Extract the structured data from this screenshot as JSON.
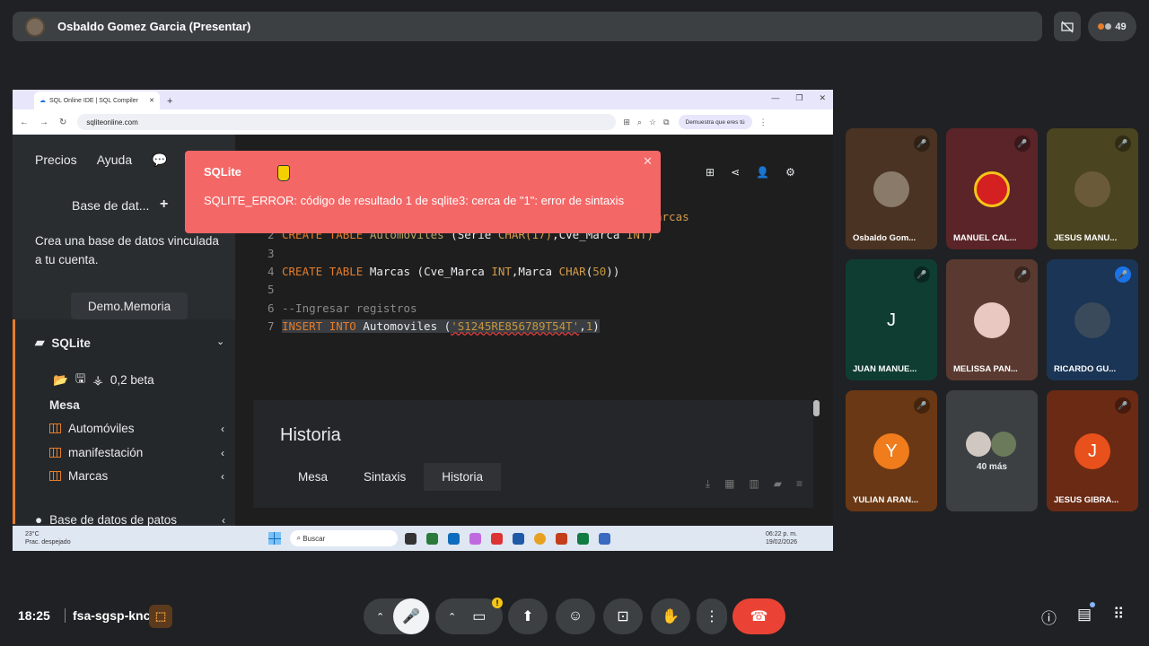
{
  "meet": {
    "presenter_name": "Osbaldo Gomez Garcia (Presentar)",
    "participant_count": "49",
    "time": "18:25",
    "meeting_code": "fsa-sgsp-knc",
    "more_label": "40 más"
  },
  "browser": {
    "tab_title": "SQL Online IDE | SQL Compiler",
    "url": "sqliteonline.com",
    "verify_label": "Demuestra que eres tú"
  },
  "app": {
    "nav": [
      "Precios",
      "Ayuda"
    ],
    "base_datos_label": "Base de dat...",
    "crea_text": "Crea una base de datos vinculada a tu cuenta.",
    "demo_label": "Demo.Memoria",
    "db_title": "SQLite",
    "version": "0,2 beta",
    "mesa_label": "Mesa",
    "tables": [
      "Automóviles",
      "manifestación",
      "Marcas"
    ],
    "patos_label": "Base de datos de patos"
  },
  "editor": {
    "line1_tail": "arcas",
    "line2_num": "2",
    "line2_kw1": "CREATE",
    "line2_kw2": "TABLE",
    "line2_name": "Automoviles",
    "line2_rest": " (Serie ",
    "line2_ty": "CHAR(17)",
    "line2_rest2": ",Cve_Marca ",
    "line2_ty2": "INT)",
    "line3_num": "3",
    "line4_num": "4",
    "line4_kw1": "CREATE",
    "line4_kw2": "TABLE",
    "line4_name": "Marcas",
    "line4_rest": " (Cve_Marca ",
    "line4_ty": "INT",
    "line4_rest2": ",Marca ",
    "line4_ty2": "CHAR",
    "line4_rest3": "(",
    "line4_num50": "50",
    "line4_end": "))",
    "line5_num": "5",
    "line6_num": "6",
    "line6_comment": "--Ingresar registros",
    "line7_num": "7",
    "line7_kw1": "INSERT",
    "line7_kw2": "INTO",
    "line7_name": "Automoviles",
    "line7_open": " (",
    "line7_str": "'S1245RE856789T54T'",
    "line7_comma": ",",
    "line7_val": "1",
    "line7_close": ")"
  },
  "history": {
    "title": "Historia",
    "tabs": [
      "Mesa",
      "Sintaxis",
      "Historia"
    ]
  },
  "error": {
    "title": "SQLite",
    "message": "SQLITE_ERROR: código de resultado 1 de sqlite3: cerca de \"1\": error de sintaxis"
  },
  "taskbar": {
    "weather_temp": "23°C",
    "weather_desc": "Prac. despejado",
    "search_label": "Buscar",
    "clock_time": "06:22 p. m.",
    "clock_date": "19/02/2026"
  },
  "participants": [
    {
      "name": "Osbaldo Gom...",
      "color": "#4a3322"
    },
    {
      "name": "MANUEL CAL...",
      "color": "#5a2428"
    },
    {
      "name": "JESUS MANU...",
      "color": "#4a4420"
    },
    {
      "name": "JUAN MANUE...",
      "color": "#0f3d32",
      "letter": "J"
    },
    {
      "name": "MELISSA PAN...",
      "color": "#5a3a30"
    },
    {
      "name": "RICARDO GU...",
      "color": "#1a3555"
    },
    {
      "name": "YULIAN ARAN...",
      "color": "#6a3814",
      "letter": "Y"
    },
    {
      "name": "JESUS GIBRA...",
      "color": "#6a2a14",
      "letter": "J"
    }
  ],
  "colors": {
    "accent": "#e37d2a",
    "error": "#f46767",
    "end_call": "#ea4335"
  }
}
